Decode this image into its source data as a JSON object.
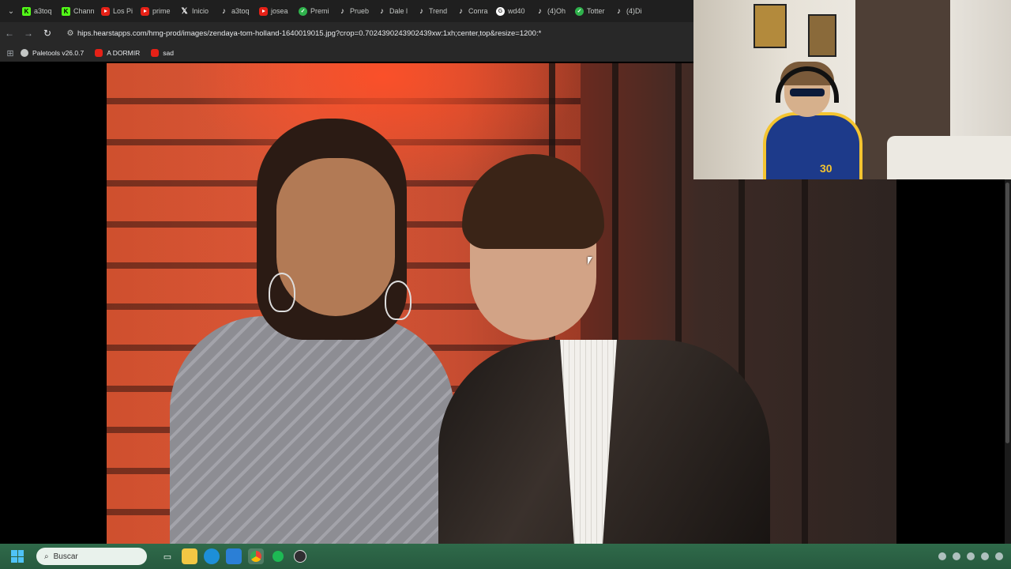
{
  "browser": {
    "tabs": [
      {
        "label": "a3toq",
        "icon": "kick"
      },
      {
        "label": "Chann",
        "icon": "kick"
      },
      {
        "label": "Los Pi",
        "icon": "youtube"
      },
      {
        "label": "prime",
        "icon": "youtube"
      },
      {
        "label": "Inicio",
        "icon": "x"
      },
      {
        "label": "a3toq",
        "icon": "tiktok"
      },
      {
        "label": "josea",
        "icon": "youtube"
      },
      {
        "label": "Premi",
        "icon": "green-circle"
      },
      {
        "label": "Prueb",
        "icon": "tiktok"
      },
      {
        "label": "Dale l",
        "icon": "tiktok"
      },
      {
        "label": "Trend",
        "icon": "tiktok"
      },
      {
        "label": "Conra",
        "icon": "tiktok"
      },
      {
        "label": "wd40",
        "icon": "chrome-grey"
      },
      {
        "label": "(4)Oh",
        "icon": "tiktok"
      },
      {
        "label": "Totter",
        "icon": "green-circle"
      },
      {
        "label": "(4)Di",
        "icon": "tiktok"
      }
    ],
    "url": "hips.hearstapps.com/hmg-prod/images/zendaya-tom-holland-1640019015.jpg?crop=0.7024390243902439xw:1xh;center,top&resize=1200:*",
    "bookmarks": [
      {
        "label": "Paletools v26.0.7",
        "icon": "globe"
      },
      {
        "label": "A DORMIR",
        "icon": "youtube"
      },
      {
        "label": "sad",
        "icon": "youtube"
      }
    ]
  },
  "taskbar": {
    "search_placeholder": "Buscar"
  },
  "webcam": {
    "jersey_number": "30"
  }
}
